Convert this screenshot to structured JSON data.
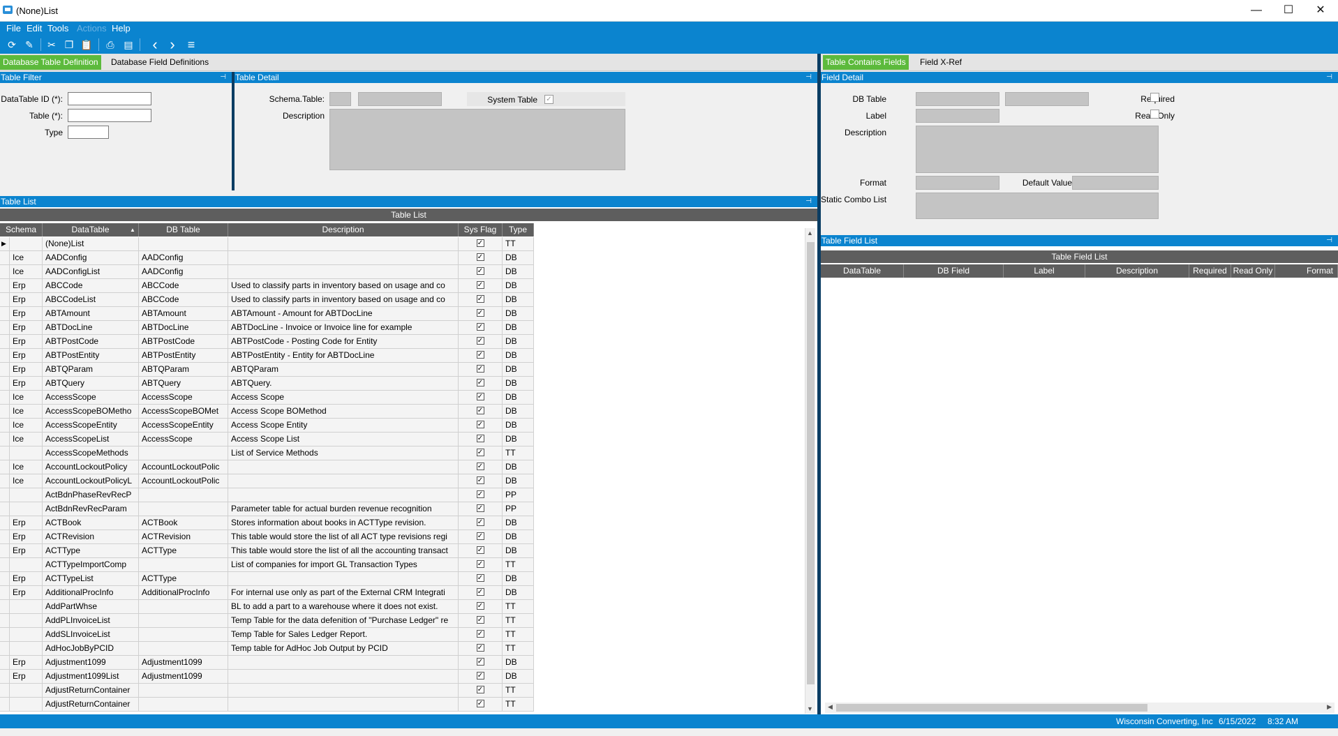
{
  "window": {
    "title": "(None)List",
    "minimize": "—",
    "maximize": "☐",
    "close": "✕"
  },
  "menu": {
    "file": "File",
    "edit": "Edit",
    "tools": "Tools",
    "actions": "Actions",
    "help": "Help"
  },
  "toolbar": {
    "refresh_icon": "⟳",
    "clear_icon": "✎",
    "cut_icon": "✂",
    "copy_icon": "❐",
    "paste_icon": "📋",
    "print_icon": "⎙",
    "preview_icon": "▤",
    "back_icon": "‹",
    "forward_icon": "›",
    "list_icon": "≡"
  },
  "left_tabs": {
    "tab1": "Database Table Definition",
    "tab2": "Database Field Definitions"
  },
  "right_tabs": {
    "tab1": "Table Contains Fields",
    "tab2": "Field X-Ref"
  },
  "table_filter": {
    "header": "Table Filter",
    "datatable_id_label": "DataTable ID (*):",
    "table_label": "Table (*):",
    "type_label": "Type"
  },
  "table_detail": {
    "header": "Table Detail",
    "schema_table_label": "Schema.Table:",
    "system_table_label": "System Table",
    "description_label": "Description"
  },
  "field_detail": {
    "header": "Field Detail",
    "db_table_label": "DB Table",
    "required_label": "Required",
    "label_label": "Label",
    "read_only_label": "Read Only",
    "description_label": "Description",
    "format_label": "Format",
    "default_value_label": "Default Value",
    "static_combo_label": "Static Combo List"
  },
  "table_list": {
    "panel_header": "Table List",
    "caption": "Table List",
    "columns": [
      "Schema",
      "DataTable",
      "DB Table",
      "Description",
      "Sys Flag",
      "Type"
    ],
    "sort_indicator": "▲",
    "rows": [
      {
        "schema": "",
        "datatable": "(None)List",
        "dbtable": "",
        "description": "",
        "sys": true,
        "type": "TT",
        "current": true
      },
      {
        "schema": "Ice",
        "datatable": "AADConfig",
        "dbtable": "AADConfig",
        "description": "",
        "sys": true,
        "type": "DB"
      },
      {
        "schema": "Ice",
        "datatable": "AADConfigList",
        "dbtable": "AADConfig",
        "description": "",
        "sys": true,
        "type": "DB"
      },
      {
        "schema": "Erp",
        "datatable": "ABCCode",
        "dbtable": "ABCCode",
        "description": "Used to classify parts in inventory based on usage and co",
        "sys": true,
        "type": "DB"
      },
      {
        "schema": "Erp",
        "datatable": "ABCCodeList",
        "dbtable": "ABCCode",
        "description": "Used to classify parts in inventory based on usage and co",
        "sys": true,
        "type": "DB"
      },
      {
        "schema": "Erp",
        "datatable": "ABTAmount",
        "dbtable": "ABTAmount",
        "description": "ABTAmount - Amount for ABTDocLine",
        "sys": true,
        "type": "DB"
      },
      {
        "schema": "Erp",
        "datatable": "ABTDocLine",
        "dbtable": "ABTDocLine",
        "description": "ABTDocLine - Invoice or Invoice line for example",
        "sys": true,
        "type": "DB"
      },
      {
        "schema": "Erp",
        "datatable": "ABTPostCode",
        "dbtable": "ABTPostCode",
        "description": "ABTPostCode - Posting Code for Entity",
        "sys": true,
        "type": "DB"
      },
      {
        "schema": "Erp",
        "datatable": "ABTPostEntity",
        "dbtable": "ABTPostEntity",
        "description": "ABTPostEntity - Entity for ABTDocLine",
        "sys": true,
        "type": "DB"
      },
      {
        "schema": "Erp",
        "datatable": "ABTQParam",
        "dbtable": "ABTQParam",
        "description": "ABTQParam",
        "sys": true,
        "type": "DB"
      },
      {
        "schema": "Erp",
        "datatable": "ABTQuery",
        "dbtable": "ABTQuery",
        "description": "ABTQuery.",
        "sys": true,
        "type": "DB"
      },
      {
        "schema": "Ice",
        "datatable": "AccessScope",
        "dbtable": "AccessScope",
        "description": "Access Scope",
        "sys": true,
        "type": "DB"
      },
      {
        "schema": "Ice",
        "datatable": "AccessScopeBOMetho",
        "dbtable": "AccessScopeBOMet",
        "description": "Access Scope BOMethod",
        "sys": true,
        "type": "DB"
      },
      {
        "schema": "Ice",
        "datatable": "AccessScopeEntity",
        "dbtable": "AccessScopeEntity",
        "description": "Access Scope Entity",
        "sys": true,
        "type": "DB"
      },
      {
        "schema": "Ice",
        "datatable": "AccessScopeList",
        "dbtable": "AccessScope",
        "description": "Access Scope List",
        "sys": true,
        "type": "DB"
      },
      {
        "schema": "",
        "datatable": "AccessScopeMethods",
        "dbtable": "",
        "description": "List of Service Methods",
        "sys": true,
        "type": "TT"
      },
      {
        "schema": "Ice",
        "datatable": "AccountLockoutPolicy",
        "dbtable": "AccountLockoutPolic",
        "description": "",
        "sys": true,
        "type": "DB"
      },
      {
        "schema": "Ice",
        "datatable": "AccountLockoutPolicyL",
        "dbtable": "AccountLockoutPolic",
        "description": "",
        "sys": true,
        "type": "DB"
      },
      {
        "schema": "",
        "datatable": "ActBdnPhaseRevRecP",
        "dbtable": "",
        "description": "",
        "sys": true,
        "type": "PP"
      },
      {
        "schema": "",
        "datatable": "ActBdnRevRecParam",
        "dbtable": "",
        "description": "Parameter table for actual burden revenue recognition",
        "sys": true,
        "type": "PP"
      },
      {
        "schema": "Erp",
        "datatable": "ACTBook",
        "dbtable": "ACTBook",
        "description": "Stores information about books in ACTType revision.",
        "sys": true,
        "type": "DB"
      },
      {
        "schema": "Erp",
        "datatable": "ACTRevision",
        "dbtable": "ACTRevision",
        "description": "This table would store the list of all ACT type revisions regi",
        "sys": true,
        "type": "DB"
      },
      {
        "schema": "Erp",
        "datatable": "ACTType",
        "dbtable": "ACTType",
        "description": "This table would store the list of all the accounting transact",
        "sys": true,
        "type": "DB"
      },
      {
        "schema": "",
        "datatable": "ACTTypeImportComp",
        "dbtable": "",
        "description": "List of companies for import GL Transaction Types",
        "sys": true,
        "type": "TT"
      },
      {
        "schema": "Erp",
        "datatable": "ACTTypeList",
        "dbtable": "ACTType",
        "description": "",
        "sys": true,
        "type": "DB"
      },
      {
        "schema": "Erp",
        "datatable": "AdditionalProcInfo",
        "dbtable": "AdditionalProcInfo",
        "description": "For internal use only as part of the External CRM Integrati",
        "sys": true,
        "type": "DB"
      },
      {
        "schema": "",
        "datatable": "AddPartWhse",
        "dbtable": "",
        "description": "BL to add a part to a warehouse where it does not exist.",
        "sys": true,
        "type": "TT"
      },
      {
        "schema": "",
        "datatable": "AddPLInvoiceList",
        "dbtable": "",
        "description": "Temp Table for the data defenition of \"Purchase Ledger\" re",
        "sys": true,
        "type": "TT"
      },
      {
        "schema": "",
        "datatable": "AddSLInvoiceList",
        "dbtable": "",
        "description": "Temp Table for Sales Ledger Report.",
        "sys": true,
        "type": "TT"
      },
      {
        "schema": "",
        "datatable": "AdHocJobByPCID",
        "dbtable": "",
        "description": "Temp table for AdHoc Job Output by PCID",
        "sys": true,
        "type": "TT"
      },
      {
        "schema": "Erp",
        "datatable": "Adjustment1099",
        "dbtable": "Adjustment1099",
        "description": "",
        "sys": true,
        "type": "DB"
      },
      {
        "schema": "Erp",
        "datatable": "Adjustment1099List",
        "dbtable": "Adjustment1099",
        "description": "",
        "sys": true,
        "type": "DB"
      },
      {
        "schema": "",
        "datatable": "AdjustReturnContainer",
        "dbtable": "",
        "description": "",
        "sys": true,
        "type": "TT"
      },
      {
        "schema": "",
        "datatable": "AdjustReturnContainer",
        "dbtable": "",
        "description": "",
        "sys": true,
        "type": "TT"
      }
    ]
  },
  "table_field_list": {
    "panel_header": "Table Field List",
    "caption": "Table Field List",
    "columns": [
      "DataTable",
      "DB Field",
      "Label",
      "Description",
      "Required",
      "Read Only",
      "Format"
    ]
  },
  "status": {
    "company": "Wisconsin Converting, Inc",
    "date": "6/15/2022",
    "time": "8:32 AM"
  },
  "colors": {
    "accent": "#0b84cf",
    "active_tab": "#5cba3c",
    "grid_header": "#5e5e5e"
  }
}
